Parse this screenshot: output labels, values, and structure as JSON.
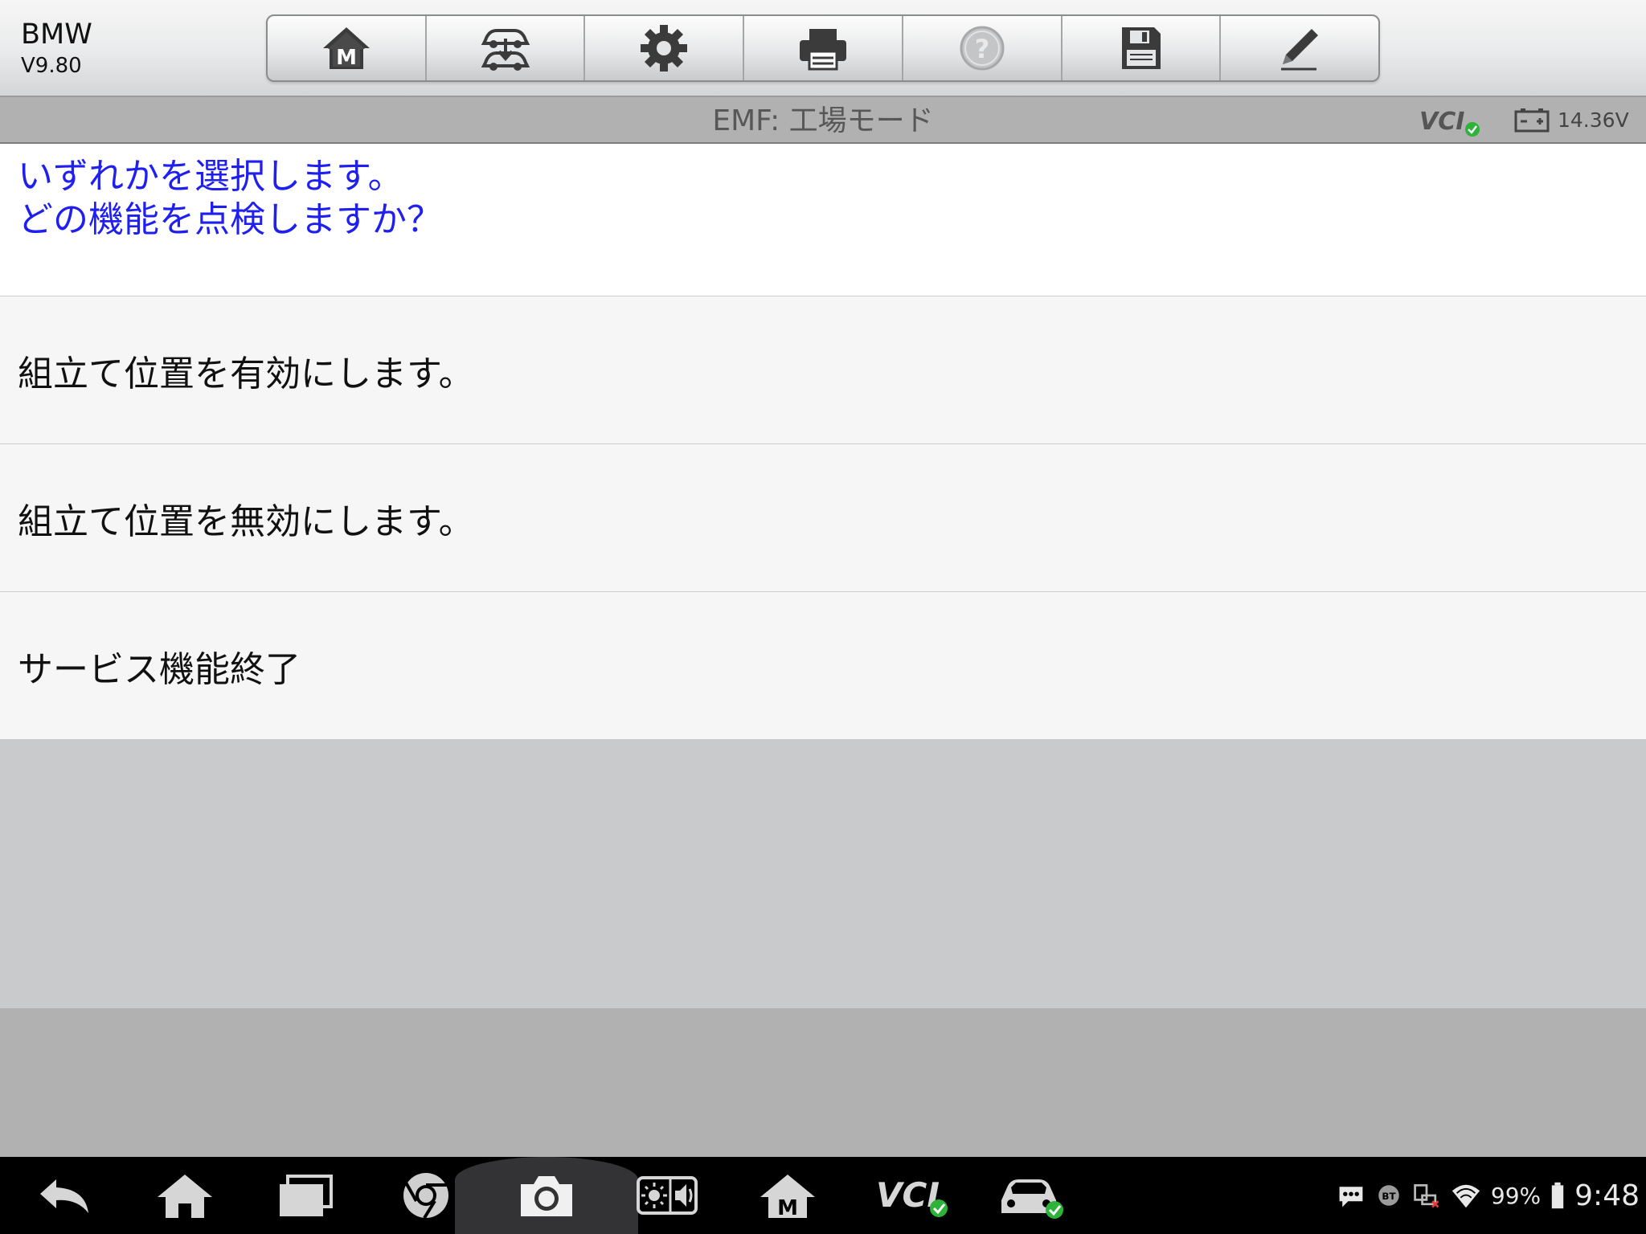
{
  "app": {
    "name": "BMW",
    "version": "V9.80"
  },
  "toolbar": {
    "buttons": [
      {
        "icon": "home-m-icon"
      },
      {
        "icon": "vehicle-swap-icon"
      },
      {
        "icon": "gear-icon"
      },
      {
        "icon": "printer-icon"
      },
      {
        "icon": "help-icon",
        "disabled": true
      },
      {
        "icon": "save-icon"
      },
      {
        "icon": "pencil-icon"
      }
    ]
  },
  "subheader": {
    "title": "EMF: 工場モード",
    "vcl_label": "VCI",
    "voltage": "14.36V"
  },
  "prompt": {
    "line1": "いずれかを選択します。",
    "line2": "どの機能を点検しますか？"
  },
  "options": [
    "組立て位置を有効にします。",
    "組立て位置を無効にします。",
    "サービス機能終了"
  ],
  "statusbar": {
    "bt_label": "BT",
    "battery": "99%",
    "time": "9:48"
  },
  "colors": {
    "prompt_text": "#1f1ff0",
    "vcl_ok": "#2db33a",
    "nav_bg": "#000000"
  }
}
